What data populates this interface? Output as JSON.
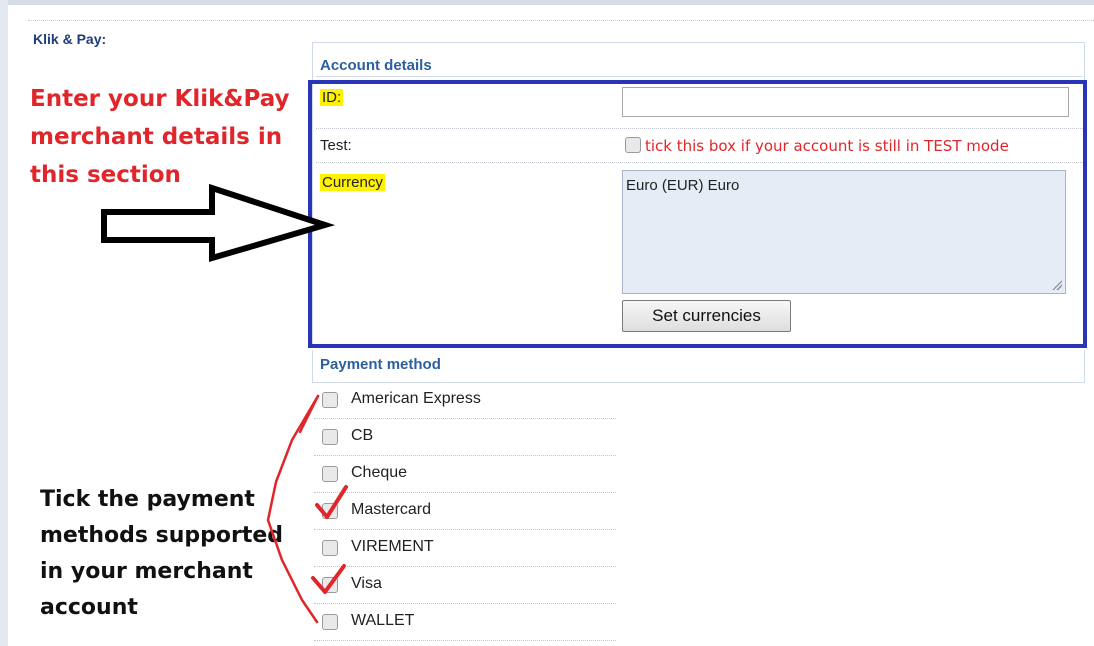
{
  "section": {
    "label": "Klik & Pay:"
  },
  "account_details": {
    "heading": "Account details",
    "id_label": "ID:",
    "id_value": "",
    "test_label": "Test:",
    "test_note": "tick this box if your account is still in TEST mode",
    "test_checked": false,
    "currency_label": "Currency",
    "currency_value": "Euro (EUR) Euro",
    "set_currencies_label": "Set currencies"
  },
  "payment_method": {
    "heading": "Payment method",
    "items": [
      {
        "label": "American Express",
        "checked": false
      },
      {
        "label": "CB",
        "checked": false
      },
      {
        "label": "Cheque",
        "checked": false
      },
      {
        "label": "Mastercard",
        "checked": false
      },
      {
        "label": "VIREMENT",
        "checked": false
      },
      {
        "label": "Visa",
        "checked": false
      },
      {
        "label": "WALLET",
        "checked": false
      }
    ]
  },
  "annotations": {
    "merchant_details": "Enter your Klik&Pay merchant details in this section",
    "payment_methods": "Tick the payment methods supported in your merchant account"
  },
  "colors": {
    "annotation_red": "#e0262a",
    "frame_blue": "#2a35b5",
    "highlight_yellow": "#fff200",
    "heading_blue": "#2c5f9e"
  }
}
